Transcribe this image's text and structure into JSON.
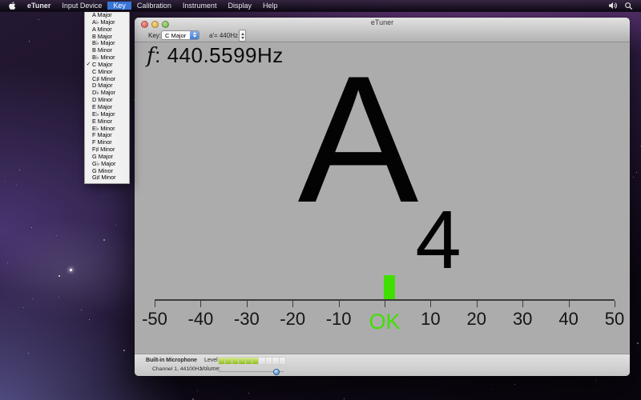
{
  "menu_bar": {
    "app_icon": "apple-icon",
    "items": [
      {
        "label": "eTuner",
        "bold": true,
        "active": false
      },
      {
        "label": "Input Device",
        "bold": false,
        "active": false
      },
      {
        "label": "Key",
        "bold": false,
        "active": true
      },
      {
        "label": "Calibration",
        "bold": false,
        "active": false
      },
      {
        "label": "Instrument",
        "bold": false,
        "active": false
      },
      {
        "label": "Display",
        "bold": false,
        "active": false
      },
      {
        "label": "Help",
        "bold": false,
        "active": false
      }
    ],
    "right_icons": [
      "volume-icon",
      "spotlight-icon"
    ]
  },
  "key_menu": {
    "checkmark": "✓",
    "items": [
      {
        "label": "A Major",
        "checked": false
      },
      {
        "label": "A♭ Major",
        "checked": false
      },
      {
        "label": "A Minor",
        "checked": false
      },
      {
        "label": "B Major",
        "checked": false
      },
      {
        "label": "B♭ Major",
        "checked": false
      },
      {
        "label": "B Minor",
        "checked": false
      },
      {
        "label": "B♭ Minor",
        "checked": false
      },
      {
        "label": "C Major",
        "checked": true
      },
      {
        "label": "C Minor",
        "checked": false
      },
      {
        "label": "C♯ Minor",
        "checked": false
      },
      {
        "label": "D Major",
        "checked": false
      },
      {
        "label": "D♭ Major",
        "checked": false
      },
      {
        "label": "D Minor",
        "checked": false
      },
      {
        "label": "E Major",
        "checked": false
      },
      {
        "label": "E♭ Major",
        "checked": false
      },
      {
        "label": "E Minor",
        "checked": false
      },
      {
        "label": "E♭ Minor",
        "checked": false
      },
      {
        "label": "F Major",
        "checked": false
      },
      {
        "label": "F Minor",
        "checked": false
      },
      {
        "label": "F♯ Minor",
        "checked": false
      },
      {
        "label": "G Major",
        "checked": false
      },
      {
        "label": "G♭ Major",
        "checked": false
      },
      {
        "label": "G Minor",
        "checked": false
      },
      {
        "label": "G♯ Minor",
        "checked": false
      }
    ]
  },
  "window": {
    "title": "eTuner",
    "toolbar": {
      "key_label": "Key:",
      "key_value": "C Major",
      "reference_pitch": "a′= 440Hz"
    },
    "display": {
      "frequency_prefix": "f",
      "frequency_rest": ": 440.5599Hz",
      "note": "A",
      "octave": "4"
    },
    "meter": {
      "ticks": [
        {
          "value": -50,
          "label": "-50"
        },
        {
          "value": -40,
          "label": "-40"
        },
        {
          "value": -30,
          "label": "-30"
        },
        {
          "value": -20,
          "label": "-20"
        },
        {
          "value": -10,
          "label": "-10"
        },
        {
          "value": 0,
          "label": "OK",
          "is_ok": true
        },
        {
          "value": 10,
          "label": "10"
        },
        {
          "value": 20,
          "label": "20"
        },
        {
          "value": 30,
          "label": "30"
        },
        {
          "value": 40,
          "label": "40"
        },
        {
          "value": 50,
          "label": "50"
        }
      ],
      "indicator_cents": 1,
      "tuner_green": "#3fe000"
    },
    "status_bar": {
      "input_name": "Built-in Microphone",
      "channel_info": "Channel 1, 44100Hz",
      "level_label": "Level:",
      "level_segments": 10,
      "level_lit": 6,
      "volume_label": "Volume:",
      "volume_value": 0.93
    }
  },
  "colors": {
    "menu_highlight": "#3875d7",
    "window_bg": "#acacac",
    "tuner_green": "#3fe000"
  }
}
